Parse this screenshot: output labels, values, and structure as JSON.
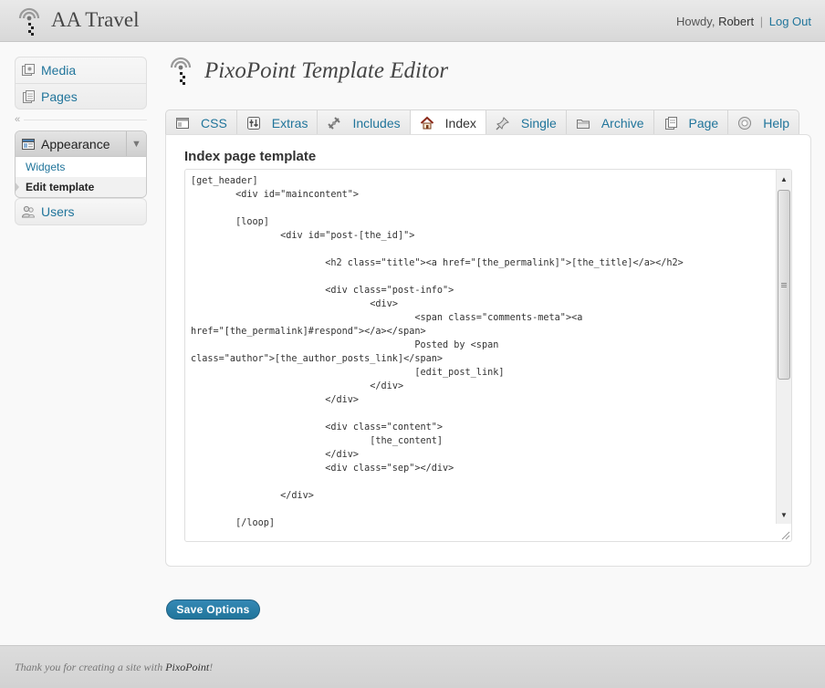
{
  "header": {
    "site_title": "AA Travel",
    "greeting": "Howdy,",
    "user_name": "Robert",
    "separator": "|",
    "logout_label": "Log Out"
  },
  "sidebar": {
    "top_items": [
      {
        "label": "Media",
        "icon": "media-icon"
      },
      {
        "label": "Pages",
        "icon": "pages-icon"
      }
    ],
    "collapse_glyph": "«",
    "appearance": {
      "label": "Appearance",
      "icon": "appearance-icon",
      "toggle_glyph": "▼",
      "submenu": [
        {
          "label": "Widgets",
          "current": false
        },
        {
          "label": "Edit template",
          "current": true
        }
      ]
    },
    "bottom_items": [
      {
        "label": "Users",
        "icon": "users-icon"
      }
    ]
  },
  "main": {
    "page_title": "PixoPoint Template Editor",
    "tabs": [
      {
        "label": "CSS",
        "icon": "css-icon",
        "active": false
      },
      {
        "label": "Extras",
        "icon": "extras-icon",
        "active": false
      },
      {
        "label": "Includes",
        "icon": "includes-icon",
        "active": false
      },
      {
        "label": "Index",
        "icon": "home-icon",
        "active": true
      },
      {
        "label": "Single",
        "icon": "pin-icon",
        "active": false
      },
      {
        "label": "Archive",
        "icon": "folder-icon",
        "active": false
      },
      {
        "label": "Page",
        "icon": "page-icon",
        "active": false
      },
      {
        "label": "Help",
        "icon": "help-icon",
        "active": false
      }
    ],
    "panel_heading": "Index page template",
    "template_code": "[get_header]\n\t<div id=\"maincontent\">\n\n\t[loop]\n\t\t<div id=\"post-[the_id]\">\n\n\t\t\t<h2 class=\"title\"><a href=\"[the_permalink]\">[the_title]</a></h2>\n\n\t\t\t<div class=\"post-info\">\n\t\t\t\t<div>\n\t\t\t\t\t<span class=\"comments-meta\"><a \nhref=\"[the_permalink]#respond\"></a></span>\n\t\t\t\t\tPosted by <span \nclass=\"author\">[the_author_posts_link]</span>\n\t\t\t\t\t[edit_post_link]\n\t\t\t\t</div>\n\t\t\t</div>\n\n\t\t\t<div class=\"content\">\n\t\t\t\t[the_content]\n\t\t\t</div>\n\t\t\t<div class=\"sep\"></div>\n\n\t\t</div>\n\n\t[/loop]",
    "save_label": "Save Options"
  },
  "footer": {
    "text_prefix": "Thank you for creating a site with ",
    "brand": "PixoPoint",
    "text_suffix": "!"
  },
  "colors": {
    "link": "#21759b",
    "button": "#21759b",
    "header_bg": "#dedede"
  }
}
